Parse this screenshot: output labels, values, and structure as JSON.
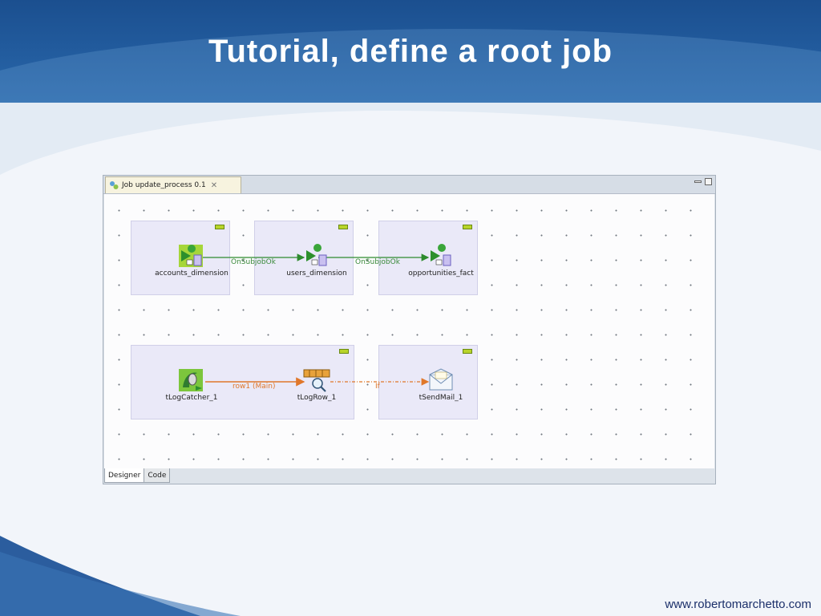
{
  "slide": {
    "title": "Tutorial, define a root job",
    "footer_url": "www.robertomarchetto.com"
  },
  "editor": {
    "tab_title": "Job update_process 0.1",
    "bottom_tabs": [
      "Designer",
      "Code"
    ],
    "components": [
      {
        "label": "accounts_dimension",
        "icon": "tRunJob-icon"
      },
      {
        "label": "users_dimension",
        "icon": "tRunJob-icon"
      },
      {
        "label": "opportunities_fact",
        "icon": "tRunJob-icon"
      },
      {
        "label": "tLogCatcher_1",
        "icon": "log-catcher-icon"
      },
      {
        "label": "tLogRow_1",
        "icon": "log-row-icon"
      },
      {
        "label": "tSendMail_1",
        "icon": "send-mail-icon"
      }
    ],
    "links": [
      {
        "label": "OnSubjobOk",
        "type": "trigger"
      },
      {
        "label": "OnSubjobOk",
        "type": "trigger"
      },
      {
        "label": "row1 (Main)",
        "type": "main"
      },
      {
        "label": "If",
        "type": "condition"
      }
    ]
  },
  "colors": {
    "header": "#1b4f8f",
    "trigger_link": "#2e8b2e",
    "main_link": "#e0772a",
    "subjob_bg": "#eae9f8"
  }
}
